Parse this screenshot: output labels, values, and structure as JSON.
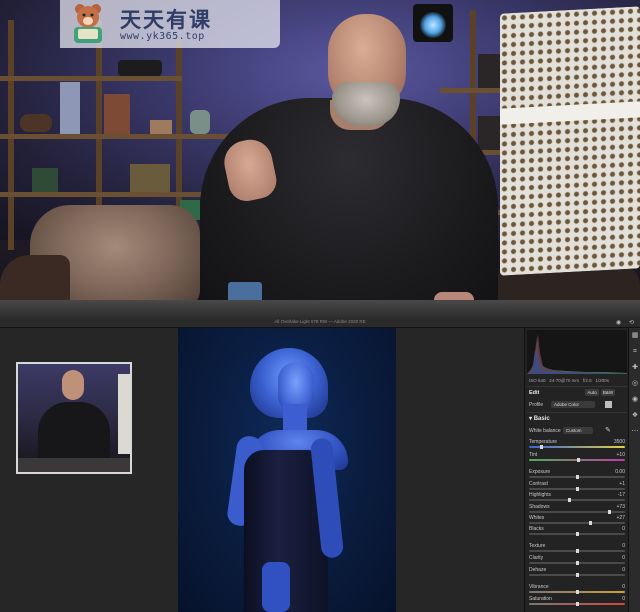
{
  "watermark": {
    "title": "天天有课",
    "url": "www.yk365.top"
  },
  "app": {
    "title": "All Overlake Light 078 RW — Adobe 2020 RE"
  },
  "panel": {
    "exif": [
      "ISO 640",
      "24-70@70 mm",
      "f/2.8",
      "1/200s"
    ],
    "edit_label": "Edit",
    "auto_label": "Auto",
    "bw_label": "B&W",
    "profile_label": "Profile",
    "profile_value": "Adobe Color",
    "basic_label": "Basic",
    "white_balance_label": "White balance",
    "white_balance_value": "Custom",
    "sliders": [
      {
        "label": "Temperature",
        "value": "3500",
        "pos": 0.12
      },
      {
        "label": "Tint",
        "value": "+10",
        "pos": 0.52
      },
      {
        "label": "Exposure",
        "value": "0.00",
        "pos": 0.5
      },
      {
        "label": "Contrast",
        "value": "+1",
        "pos": 0.5
      },
      {
        "label": "Highlights",
        "value": "-17",
        "pos": 0.42
      },
      {
        "label": "Shadows",
        "value": "+73",
        "pos": 0.85
      },
      {
        "label": "Whites",
        "value": "+27",
        "pos": 0.64
      },
      {
        "label": "Blacks",
        "value": "0",
        "pos": 0.5
      },
      {
        "label": "Texture",
        "value": "0",
        "pos": 0.5
      },
      {
        "label": "Clarity",
        "value": "0",
        "pos": 0.5
      },
      {
        "label": "Dehaze",
        "value": "0",
        "pos": 0.5
      },
      {
        "label": "Vibrance",
        "value": "0",
        "pos": 0.5
      },
      {
        "label": "Saturation",
        "value": "0",
        "pos": 0.5
      }
    ]
  },
  "icons": {
    "tools": [
      "histogram-toggle-icon",
      "crop-icon",
      "healing-icon",
      "mask-icon",
      "redeye-icon",
      "presets-icon",
      "more-icon"
    ]
  }
}
